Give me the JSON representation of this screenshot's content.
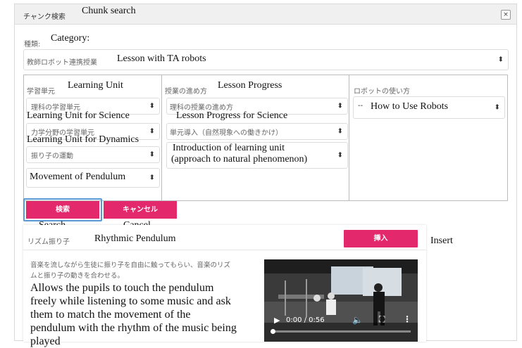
{
  "dialog": {
    "title_jp": "チャンク検索",
    "title_en": "Chunk search",
    "close_glyph": "×"
  },
  "category": {
    "label_jp": "種類:",
    "label_en": "Category:",
    "value_jp": "教師ロボット連携授業",
    "value_en": "Lesson with TA robots"
  },
  "columns": {
    "learning_unit": {
      "header_jp": "学習単元",
      "header_en": "Learning Unit",
      "select1_jp": "理科の学習単元",
      "select1_en": "Learning Unit for Science",
      "select2_jp": "力学分野の学習単元",
      "select2_en": "Learning Unit for Dynamics",
      "select3_jp": "振り子の運動",
      "select4_value": "Movement of Pendulum"
    },
    "lesson_progress": {
      "header_jp": "授業の進め方",
      "header_en": "Lesson Progress",
      "select1_jp": "理科の授業の進め方",
      "select1_en": "Lesson Progress for Science",
      "select2_jp": "単元導入（自然現象への働きかけ）",
      "select3_en_line1": "Introduction of learning unit",
      "select3_en_line2": "(approach to natural phenomenon)"
    },
    "robot_usage": {
      "header_jp": "ロボットの使い方",
      "select1_prefix": "--",
      "select1_en": "How to Use Robots"
    }
  },
  "buttons": {
    "search_jp": "検索",
    "search_en": "Search",
    "cancel_jp": "キャンセル",
    "cancel_en": "Cancel",
    "insert_jp": "挿入",
    "insert_en": "Insert"
  },
  "result": {
    "title_jp": "リズム振り子",
    "title_en": "Rhythmic Pendulum",
    "desc_jp_line1": "音楽を流しながら生徒に振り子を自由に触ってもらい、音楽のリズ",
    "desc_jp_line2": "ムと振り子の動きを合わせる。",
    "desc_en_line1": "Allows the pupils to touch the pendulum",
    "desc_en_line2": "freely while listening to some music and ask",
    "desc_en_line3": "them to match the movement of the",
    "desc_en_line4": "pendulum with the rhythm of the music being",
    "desc_en_line5": "played"
  },
  "video": {
    "time": "0:00 / 0:56",
    "progress": 0.0,
    "icons": [
      "play-icon",
      "volume-icon",
      "fullscreen-icon",
      "more-icon"
    ]
  },
  "colors": {
    "accent": "#e3286b",
    "focus": "#5b9bd5"
  }
}
